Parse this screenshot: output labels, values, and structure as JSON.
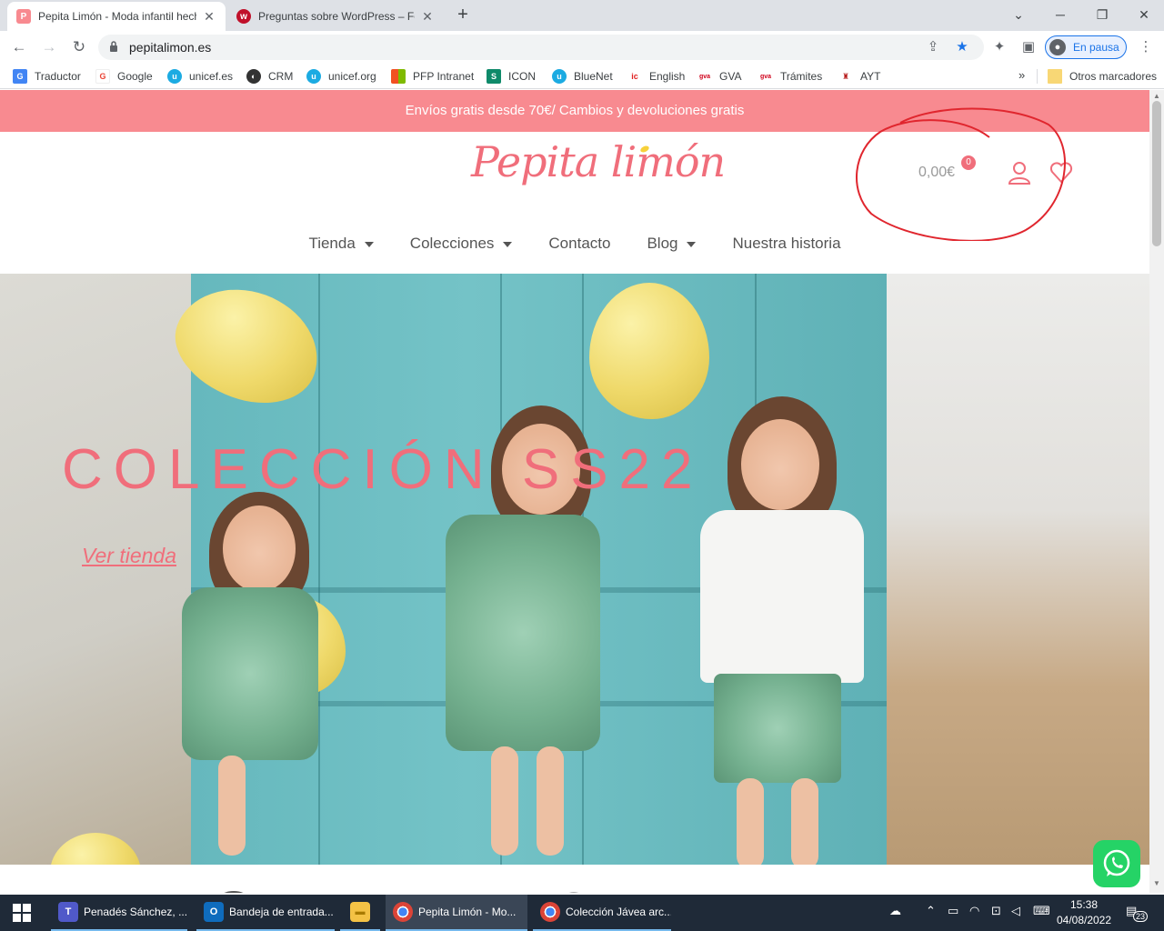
{
  "browser": {
    "tabs": [
      {
        "title": "Pepita Limón - Moda infantil hecha",
        "favicon_letter": "P",
        "favicon_color": "#f88a90"
      },
      {
        "title": "Preguntas sobre WordPress – Foro",
        "favicon_letter": "w",
        "favicon_color": "#c0102a"
      }
    ],
    "url": "pepitalimon.es",
    "profile_label": "En pausa",
    "bookmarks": [
      {
        "label": "Traductor",
        "icon": "translate-icon",
        "color": "#4285f4",
        "glyph": "G"
      },
      {
        "label": "Google",
        "icon": "google-icon",
        "color": "#ea4335",
        "glyph": "G"
      },
      {
        "label": "unicef.es",
        "icon": "unicef-icon",
        "color": "#1cabe2",
        "glyph": "u"
      },
      {
        "label": "CRM",
        "icon": "crm-icon",
        "color": "#333333",
        "glyph": "◐"
      },
      {
        "label": "unicef.org",
        "icon": "unicef-icon",
        "color": "#1cabe2",
        "glyph": "u"
      },
      {
        "label": "PFP Intranet",
        "icon": "windows-icon",
        "color": "#f25022",
        "glyph": "▦"
      },
      {
        "label": "ICON",
        "icon": "icon-s-icon",
        "color": "#0f8a6a",
        "glyph": "S"
      },
      {
        "label": "BlueNet",
        "icon": "bluenet-icon",
        "color": "#1cabe2",
        "glyph": "u"
      },
      {
        "label": "English",
        "icon": "english-icon",
        "color": "#e02020",
        "glyph": "ic"
      },
      {
        "label": "GVA",
        "icon": "gva-icon",
        "color": "#d0021b",
        "glyph": "gva"
      },
      {
        "label": "Trámites",
        "icon": "gva-icon",
        "color": "#d0021b",
        "glyph": "gva"
      },
      {
        "label": "AYT",
        "icon": "ayt-icon",
        "color": "#b71c1c",
        "glyph": "♜"
      }
    ],
    "bookmarks_more": "»",
    "other_bookmarks": "Otros marcadores"
  },
  "page": {
    "promo": "Envíos gratis desde 70€/ Cambios y devoluciones gratis",
    "logo": "Pepita limón",
    "cart_total": "0,00€",
    "cart_count": "0",
    "nav": [
      {
        "label": "Tienda",
        "dropdown": true
      },
      {
        "label": "Colecciones",
        "dropdown": true
      },
      {
        "label": "Contacto",
        "dropdown": false
      },
      {
        "label": "Blog",
        "dropdown": true
      },
      {
        "label": "Nuestra historia",
        "dropdown": false
      }
    ],
    "hero_title": "COLECCIÓN SS22",
    "hero_link": "Ver tienda",
    "accent_color": "#f06e7b",
    "promo_color": "#f88a90"
  },
  "taskbar": {
    "apps": [
      {
        "label": "Penadés Sánchez, ...",
        "icon": "teams-icon",
        "color": "#5059c9",
        "glyph": "T"
      },
      {
        "label": "Bandeja de entrada...",
        "icon": "outlook-icon",
        "color": "#0f6cbd",
        "glyph": "O"
      },
      {
        "label": "",
        "icon": "file-explorer-icon",
        "color": "#f4c245",
        "glyph": "▬"
      },
      {
        "label": "Pepita Limón - Mo...",
        "icon": "chrome-icon",
        "color": "#4285f4",
        "glyph": "◉"
      },
      {
        "label": "Colección Jávea arc...",
        "icon": "chrome-icon",
        "color": "#4285f4",
        "glyph": "◉"
      }
    ],
    "time": "15:38",
    "date": "04/08/2022",
    "notifications": "23"
  }
}
